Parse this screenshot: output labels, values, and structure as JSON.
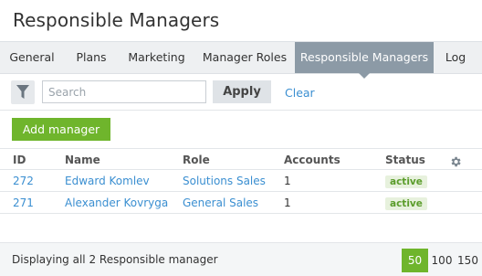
{
  "page": {
    "title": "Responsible Managers"
  },
  "tabs": [
    {
      "label": "General"
    },
    {
      "label": "Plans"
    },
    {
      "label": "Marketing"
    },
    {
      "label": "Manager Roles"
    },
    {
      "label": "Responsible Managers",
      "active": true
    },
    {
      "label": "Log"
    }
  ],
  "filter": {
    "icon": "funnel-icon",
    "search_placeholder": "Search",
    "search_value": "",
    "apply_label": "Apply",
    "clear_label": "Clear"
  },
  "toolbar": {
    "add_label": "Add manager"
  },
  "table": {
    "columns": [
      "ID",
      "Name",
      "Role",
      "Accounts",
      "Status"
    ],
    "settings_icon": "gear-icon",
    "rows": [
      {
        "id": "272",
        "name": "Edward Komlev",
        "role": "Solutions Sales",
        "accounts": "1",
        "status": "active"
      },
      {
        "id": "271",
        "name": "Alexander Kovryga",
        "role": "General Sales",
        "accounts": "1",
        "status": "active"
      }
    ]
  },
  "footer": {
    "summary": "Displaying all 2 Responsible manager",
    "page_sizes": [
      "50",
      "100",
      "150"
    ],
    "selected_page_size": "50"
  },
  "colors": {
    "accent_green": "#6fb52c",
    "link_blue": "#3b8fd1",
    "active_tab": "#8c9aa6"
  }
}
